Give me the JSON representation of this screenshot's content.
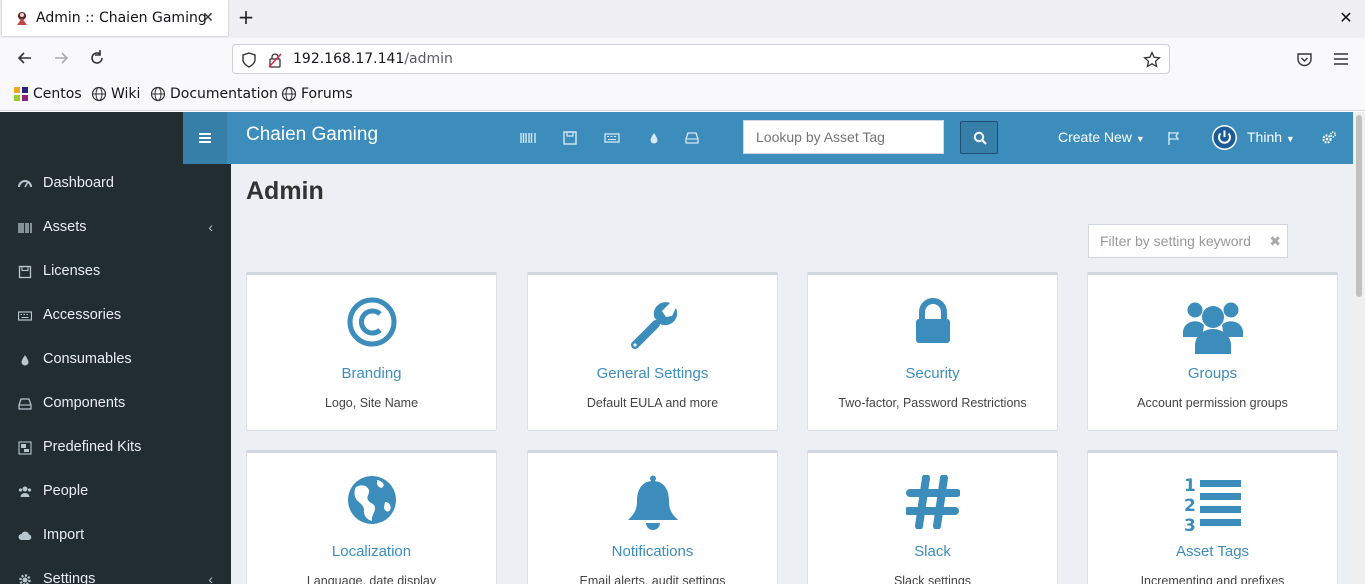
{
  "browser": {
    "tab_title": "Admin :: Chaien Gaming",
    "url_host": "192.168.17.141",
    "url_path": "/admin",
    "bookmarks": [
      "Centos",
      "Wiki",
      "Documentation",
      "Forums"
    ]
  },
  "app": {
    "brand": "Chaien Gaming",
    "search_placeholder": "Lookup by Asset Tag",
    "create_new": "Create New",
    "user_name": "Thinh",
    "accent_color": "#3c8dbc",
    "sidebar_color": "#222d32"
  },
  "sidebar": {
    "items": [
      {
        "label": "Dashboard",
        "icon": "dashboard-icon"
      },
      {
        "label": "Assets",
        "icon": "barcode-icon"
      },
      {
        "label": "Licenses",
        "icon": "floppy-icon"
      },
      {
        "label": "Accessories",
        "icon": "keyboard-icon"
      },
      {
        "label": "Consumables",
        "icon": "tint-icon"
      },
      {
        "label": "Components",
        "icon": "hdd-icon"
      },
      {
        "label": "Predefined Kits",
        "icon": "object-group-icon"
      },
      {
        "label": "People",
        "icon": "users-icon"
      },
      {
        "label": "Import",
        "icon": "cloud-upload-icon"
      },
      {
        "label": "Settings",
        "icon": "cog-icon"
      }
    ]
  },
  "main": {
    "page_title": "Admin",
    "filter_placeholder": "Filter by setting keyword",
    "cards": [
      {
        "title": "Branding",
        "desc": "Logo, Site Name"
      },
      {
        "title": "General Settings",
        "desc": "Default EULA and more"
      },
      {
        "title": "Security",
        "desc": "Two-factor, Password Restrictions"
      },
      {
        "title": "Groups",
        "desc": "Account permission groups"
      },
      {
        "title": "Localization",
        "desc": "Language, date display"
      },
      {
        "title": "Notifications",
        "desc": "Email alerts, audit settings"
      },
      {
        "title": "Slack",
        "desc": "Slack settings"
      },
      {
        "title": "Asset Tags",
        "desc": "Incrementing and prefixes"
      }
    ]
  }
}
